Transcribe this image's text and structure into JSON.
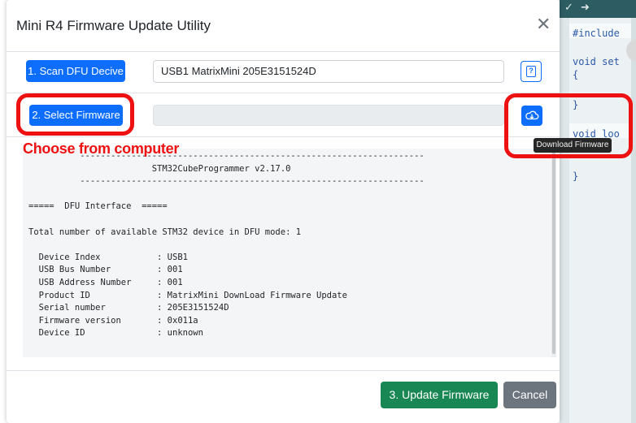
{
  "dialog": {
    "title": "Mini R4 Firmware Update Utility",
    "close_glyph": "✕"
  },
  "row1": {
    "scan_button": "1. Scan DFU Decive",
    "device_value": "USB1 MatrixMini 205E3151524D",
    "help_icon": "question-square-icon",
    "help_glyph": "?"
  },
  "row2": {
    "select_button": "2. Select Firmware",
    "firmware_value": "",
    "download_icon": "cloud-download-icon"
  },
  "annotation": "Choose from computer",
  "tooltip": "Download Firmware",
  "log_text": "          -------------------------------------------------------------------\n                        STM32CubeProgrammer v2.17.0\n          -------------------------------------------------------------------\n\n=====  DFU Interface  =====\n\nTotal number of available STM32 device in DFU mode: 1\n\n  Device Index           : USB1\n  USB Bus Number         : 001\n  USB Address Number     : 001\n  Product ID             : MatrixMini DownLoad Firmware Update\n  Serial number          : 205E3151524D\n  Firmware version       : 0x011a\n  Device ID              : unknown",
  "footer": {
    "update_button": "3. Update Firmware",
    "cancel_button": "Cancel"
  },
  "editor": {
    "lines": [
      "#include",
      "void set",
      "{",
      "}",
      "void loo",
      "{",
      "}"
    ]
  },
  "colors": {
    "primary": "#0d6efd",
    "success": "#198754",
    "secondary": "#6c757d",
    "annotation_red": "#ee1111"
  }
}
